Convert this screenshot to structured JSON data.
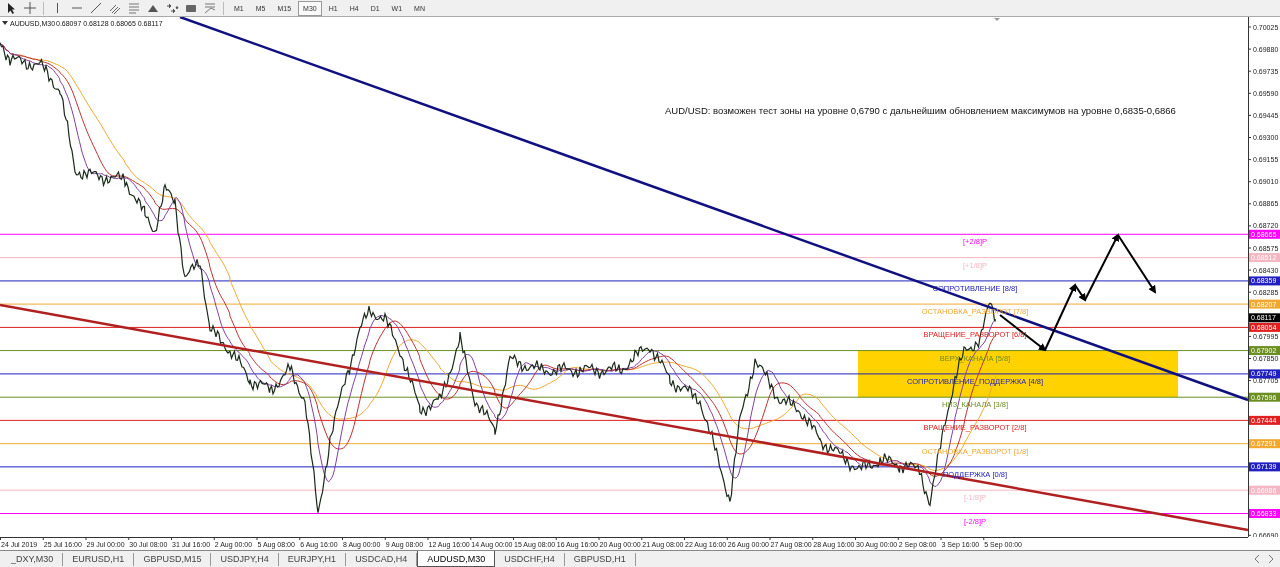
{
  "toolbar": {
    "tools": [
      {
        "kind": "cursor"
      },
      {
        "kind": "crosshair"
      },
      {
        "kind": "vline"
      },
      {
        "kind": "hline"
      },
      {
        "kind": "trend"
      },
      {
        "kind": "channel"
      },
      {
        "kind": "fibo"
      },
      {
        "kind": "triangle"
      },
      {
        "kind": "arrows"
      },
      {
        "kind": "rect"
      },
      {
        "kind": "fan"
      }
    ],
    "timeframes": [
      {
        "label": "M1",
        "selected": false
      },
      {
        "label": "M5",
        "selected": false
      },
      {
        "label": "M15",
        "selected": false
      },
      {
        "label": "M30",
        "selected": true
      },
      {
        "label": "H1",
        "selected": false
      },
      {
        "label": "H4",
        "selected": false
      },
      {
        "label": "D1",
        "selected": false
      },
      {
        "label": "W1",
        "selected": false
      },
      {
        "label": "MN",
        "selected": false
      }
    ]
  },
  "chart": {
    "symbol": "AUDUSD,M30",
    "ohlc": [
      "0.68097",
      "0.68128",
      "0.68065",
      "0.68117"
    ],
    "annotation": "AUD/USD: возможен тест зоны на уровне 0,6790 с дальнейшим обновлением максимумов на уровне 0,6835-0,6866",
    "price_ticks": [
      "0.70025",
      "0.69880",
      "0.69735",
      "0.69590",
      "0.69445",
      "0.69300",
      "0.69155",
      "0.69010",
      "0.68865",
      "0.68720",
      "0.68575",
      "0.68430",
      "0.68285",
      "0.67995",
      "0.67850",
      "0.67705",
      "0.66690"
    ],
    "current_price": "0.68117",
    "levels": [
      {
        "name": "[+2/8]P",
        "price": "0.68665",
        "color": "#ff00ff"
      },
      {
        "name": "[+1/8]P",
        "price": "0.68512",
        "color": "#f4b6c2"
      },
      {
        "name": "СОПРОТИВЛЕНИЕ [8/8]",
        "price": "0.68359",
        "color": "#2020c0"
      },
      {
        "name": "ОСТАНОВКА_РАЗВОРОТ [7/8]",
        "price": "0.68207",
        "color": "#f0a830"
      },
      {
        "name": "ВРАЩЕНИЕ_РАЗВОРОТ [6/8]",
        "price": "0.68054",
        "color": "#e02020"
      },
      {
        "name": "ВЕРХ_КАНАЛА [5/8]",
        "price": "0.67902",
        "color": "#6b8e23"
      },
      {
        "name": "СОПРОТИВЛЕНИЕ_ПОДДЕРЖКА [4/8]",
        "price": "0.67749",
        "color": "#2020c0"
      },
      {
        "name": "НИЗ_КАНАЛА [3/8]",
        "price": "0.67596",
        "color": "#6b8e23"
      },
      {
        "name": "ВРАЩЕНИЕ_РАЗВОРОТ [2/8]",
        "price": "0.67444",
        "color": "#e02020"
      },
      {
        "name": "ОСТАНОВКА_РАЗВОРОТ [1/8]",
        "price": "0.67291",
        "color": "#f0a830"
      },
      {
        "name": "ПОДДЕРЖКА [0/8]",
        "price": "0.67139",
        "color": "#2020c0"
      },
      {
        "name": "[-1/8]P",
        "price": "0.66986",
        "color": "#f4b6c2"
      },
      {
        "name": "[-2/8]P",
        "price": "0.66833",
        "color": "#ff00ff"
      }
    ],
    "time_labels": [
      "24 Jul 2019",
      "25 Jul 16:00",
      "29 Jul 00:00",
      "30 Jul 08:00",
      "31 Jul 16:00",
      "2 Aug 00:00",
      "5 Aug 08:00",
      "6 Aug 16:00",
      "8 Aug 00:00",
      "9 Aug 08:00",
      "12 Aug 16:00",
      "14 Aug 00:00",
      "15 Aug 08:00",
      "16 Aug 16:00",
      "20 Aug 00:00",
      "21 Aug 08:00",
      "22 Aug 16:00",
      "26 Aug 00:00",
      "27 Aug 08:00",
      "28 Aug 16:00",
      "30 Aug 00:00",
      "2 Sep 08:00",
      "3 Sep 16:00",
      "5 Sep 00:00"
    ]
  },
  "tabs": [
    {
      "label": "_DXY,M30",
      "selected": false
    },
    {
      "label": "EURUSD,H1",
      "selected": false
    },
    {
      "label": "GBPUSD,M15",
      "selected": false
    },
    {
      "label": "USDJPY,H4",
      "selected": false
    },
    {
      "label": "EURJPY,H1",
      "selected": false
    },
    {
      "label": "USDCAD,H4",
      "selected": false
    },
    {
      "label": "AUDUSD,M30",
      "selected": true
    },
    {
      "label": "USDCHF,H4",
      "selected": false
    },
    {
      "label": "GBPUSD,H1",
      "selected": false
    }
  ]
}
